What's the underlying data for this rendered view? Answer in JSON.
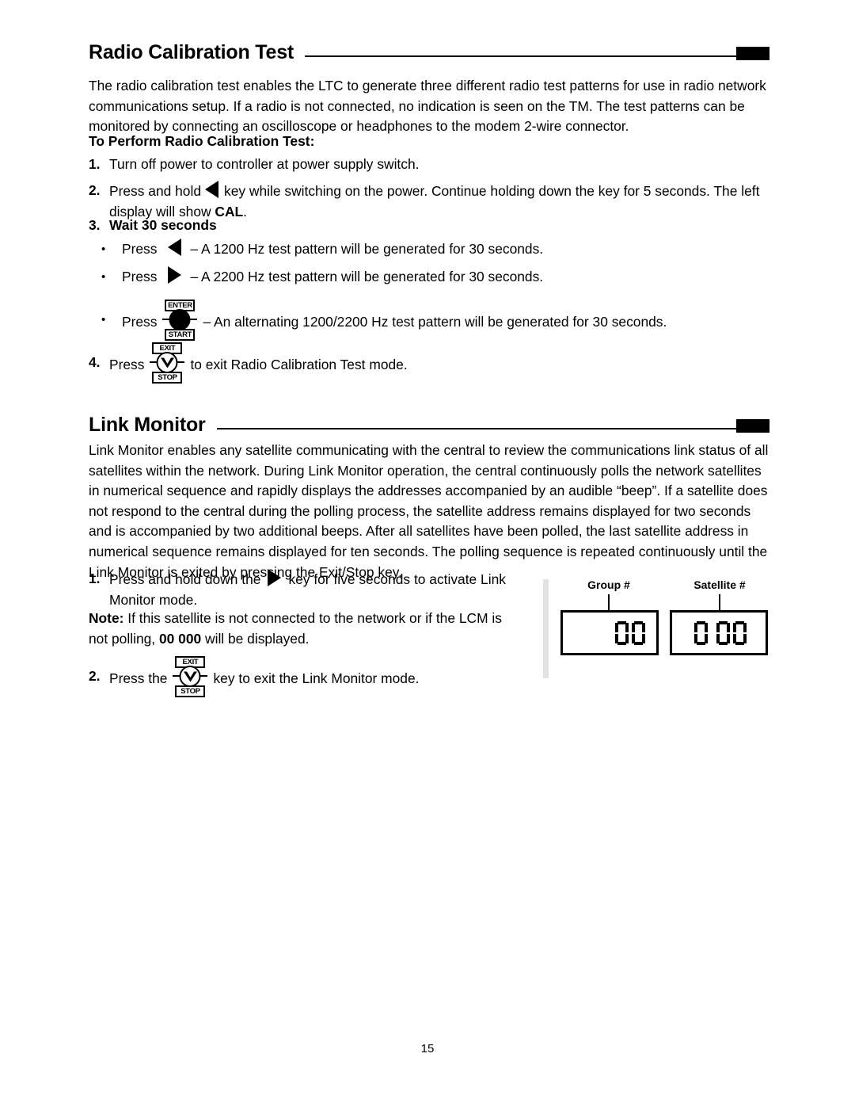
{
  "page": {
    "folio": "15"
  },
  "section_radio": {
    "title": "Radio Calibration Test",
    "intro": "The radio calibration test enables the LTC to generate three different radio test patterns for use in radio network communications setup. If a radio is not connected, no indication is seen on the TM. The test patterns can be monitored by connecting an oscilloscope or headphones to the modem 2-wire connector.",
    "subhead": "To Perform Radio Calibration Test:",
    "step1_num": "1.",
    "step1_text": "Turn off power to controller at power supply switch.",
    "step2_num": "2.",
    "step2_text_a": "Press and hold",
    "step2_text_b": "key while switching on the power. Continue holding down the key for 5 seconds. The left display will show",
    "step2_bold": "CAL",
    "step2_text_c": ".",
    "step3_num": "3.",
    "step3_text": "Wait 30 seconds",
    "bullet_glyph": "•",
    "b1_press": "Press",
    "b1_text": "– A 1200 Hz test pattern will be generated for 30 seconds.",
    "b2_press": "Press",
    "b2_text": "– A 2200 Hz test pattern will be generated for 30 seconds.",
    "b3_press": "Press",
    "b3_text": "– An alternating 1200/2200 Hz test pattern will be generated for 30 seconds.",
    "step4_num": "4.",
    "step4_text_a": "Press",
    "step4_text_b": "to exit Radio Calibration Test mode."
  },
  "keys": {
    "enter_label": "ENTER",
    "start_label": "START",
    "exit_label": "EXIT",
    "stop_label": "STOP",
    "left_arrow_name": "left-arrow-key",
    "right_arrow_name": "right-arrow-key"
  },
  "section_link": {
    "title": "Link Monitor",
    "intro": "Link Monitor enables any satellite communicating with the central to review the communications link status of all satellites within the network. During Link Monitor operation, the central continuously polls the network satellites in numerical sequence and rapidly displays the addresses accompanied by an audible “beep”. If a satellite does not respond to the central during the polling process, the satellite address remains displayed for two seconds and is accompanied by two additional beeps. After all satellites have been polled, the last satellite address in numerical sequence remains displayed for ten seconds. The polling sequence is repeated continuously until the  Link Monitor is exited by pressing the Exit/Stop key.",
    "step1_num": "1.",
    "step1_text_a": "Press and hold down the",
    "step1_text_b": "key for five seconds to activate Link Monitor mode.",
    "note_label": "Note:",
    "note_text_a": "If this satellite is not connected to the network or if the LCM is not polling,",
    "note_bold": "00  000",
    "note_text_b": "will be displayed.",
    "step2_num": "2.",
    "step2_text_a": "Press the",
    "step2_text_b": "key to exit the Link Monitor mode."
  },
  "display_panel": {
    "group_label": "Group #",
    "satellite_label": "Satellite #",
    "group_digits": [
      "0",
      "0"
    ],
    "satellite_digits": [
      "0",
      "0",
      "0"
    ]
  }
}
